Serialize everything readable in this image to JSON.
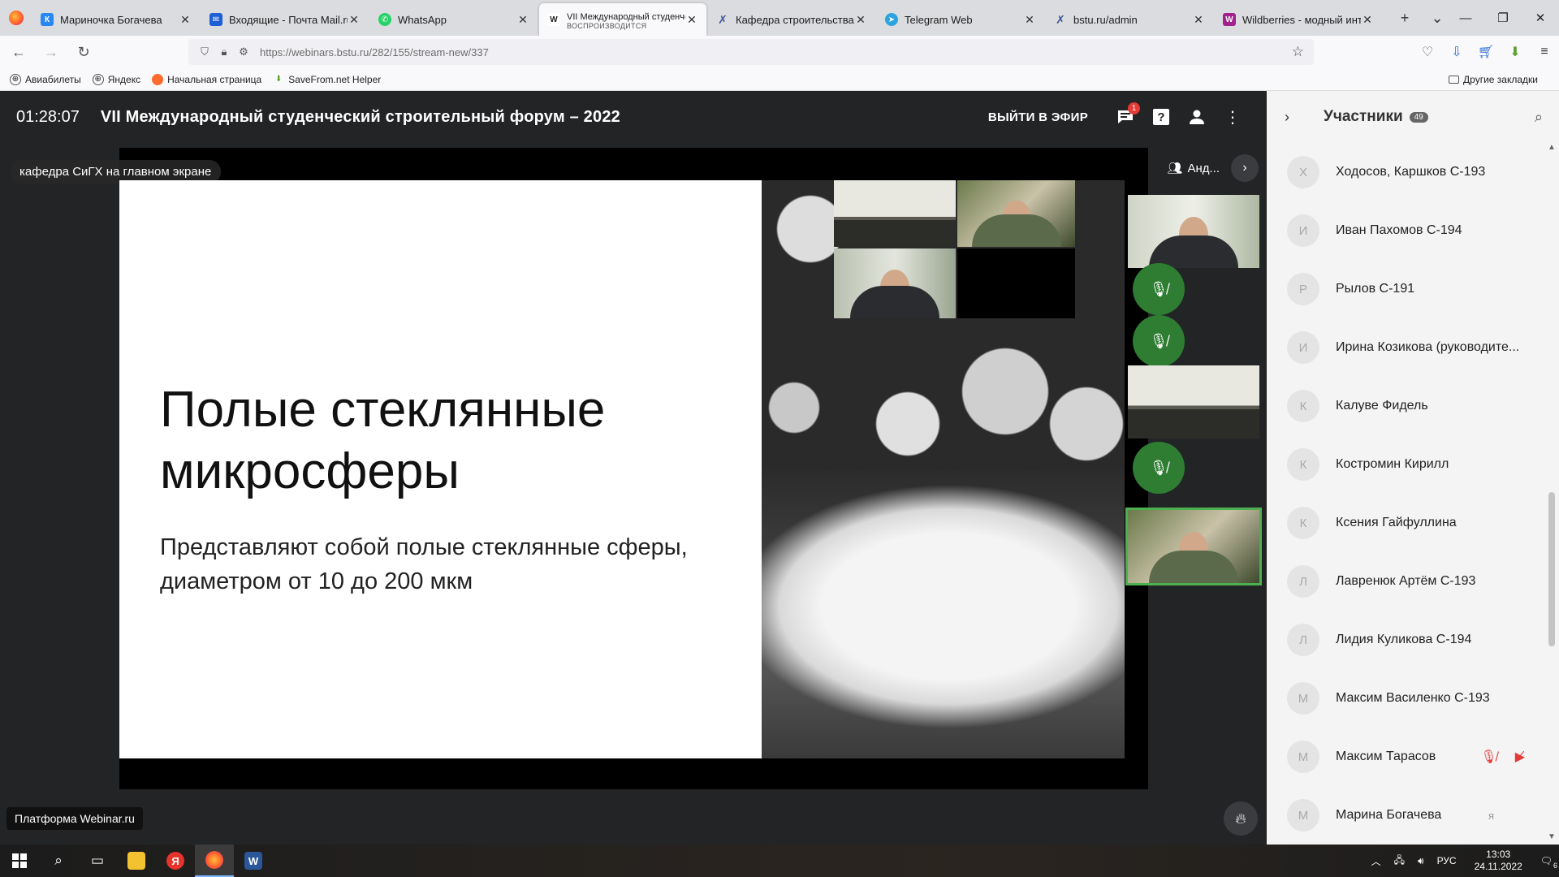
{
  "browser": {
    "tabs": [
      {
        "title": "Мариночка Богачева",
        "fav_color": "#2787f5",
        "fav_letter": "К",
        "active": false
      },
      {
        "title": "Входящие - Почта Mail.ru",
        "fav_color": "#1e5fd6",
        "fav_letter": "✉",
        "active": false
      },
      {
        "title": "WhatsApp",
        "fav_color": "#25d366",
        "fav_letter": "✆",
        "active": false
      },
      {
        "title": "VII Международный студенческий строительный форум",
        "subtitle": "ВОСПРОИЗВОДИТСЯ",
        "fav_color": "#222222",
        "fav_letter": "W",
        "active": true
      },
      {
        "title": "Кафедра строительства и городского хозяйства",
        "fav_color": "#3b5998",
        "fav_letter": "✗",
        "active": false
      },
      {
        "title": "Telegram Web",
        "fav_color": "#2aa3df",
        "fav_letter": "➤",
        "active": false
      },
      {
        "title": "bstu.ru/admin",
        "fav_color": "#3b5998",
        "fav_letter": "✗",
        "active": false
      },
      {
        "title": "Wildberries - модный интернет-магазин",
        "fav_color": "#a3208f",
        "fav_letter": "W",
        "active": false
      }
    ],
    "url": "https://webinars.bstu.ru/282/155/stream-new/337",
    "bookmarks": [
      "Авиабилеты",
      "Яндекс",
      "Начальная страница",
      "SaveFrom.net Helper"
    ],
    "other_bookmarks": "Другие закладки"
  },
  "webinar": {
    "timer": "01:28:07",
    "title": "VII Международный студенческий строительный форум – 2022",
    "go_live": "ВЫЙТИ В ЭФИР",
    "chat_badge": "1",
    "screen_label": "кафедра СиГХ на главном экране",
    "slide": {
      "title": "Полые стеклянные микросферы",
      "text": "Представляют собой полые стеклянные сферы, диаметром от 10 до 200 мкм"
    },
    "side_header": "Анд...",
    "platform": "Платформа Webinar.ru"
  },
  "participants": {
    "title": "Участники",
    "count": "49",
    "items": [
      {
        "initial": "Х",
        "name": "Ходосов, Каршков С-193"
      },
      {
        "initial": "И",
        "name": "Иван Пахомов С-194"
      },
      {
        "initial": "Р",
        "name": "Рылов С-191"
      },
      {
        "initial": "И",
        "name": "Ирина Козикова (руководите..."
      },
      {
        "initial": "К",
        "name": "Калуве Фидель"
      },
      {
        "initial": "К",
        "name": "Костромин Кирилл"
      },
      {
        "initial": "К",
        "name": "Ксения Гайфуллина"
      },
      {
        "initial": "Л",
        "name": "Лавренюк Артём С-193"
      },
      {
        "initial": "Л",
        "name": "Лидия Куликова С-194"
      },
      {
        "initial": "М",
        "name": "Максим Василенко С-193"
      },
      {
        "initial": "М",
        "name": "Максим Тарасов",
        "muted": true
      },
      {
        "initial": "М",
        "name": "Марина Богачева",
        "self": "я"
      }
    ]
  },
  "taskbar": {
    "lang": "РУС",
    "time": "13:03",
    "date": "24.11.2022",
    "notifications": "6"
  }
}
